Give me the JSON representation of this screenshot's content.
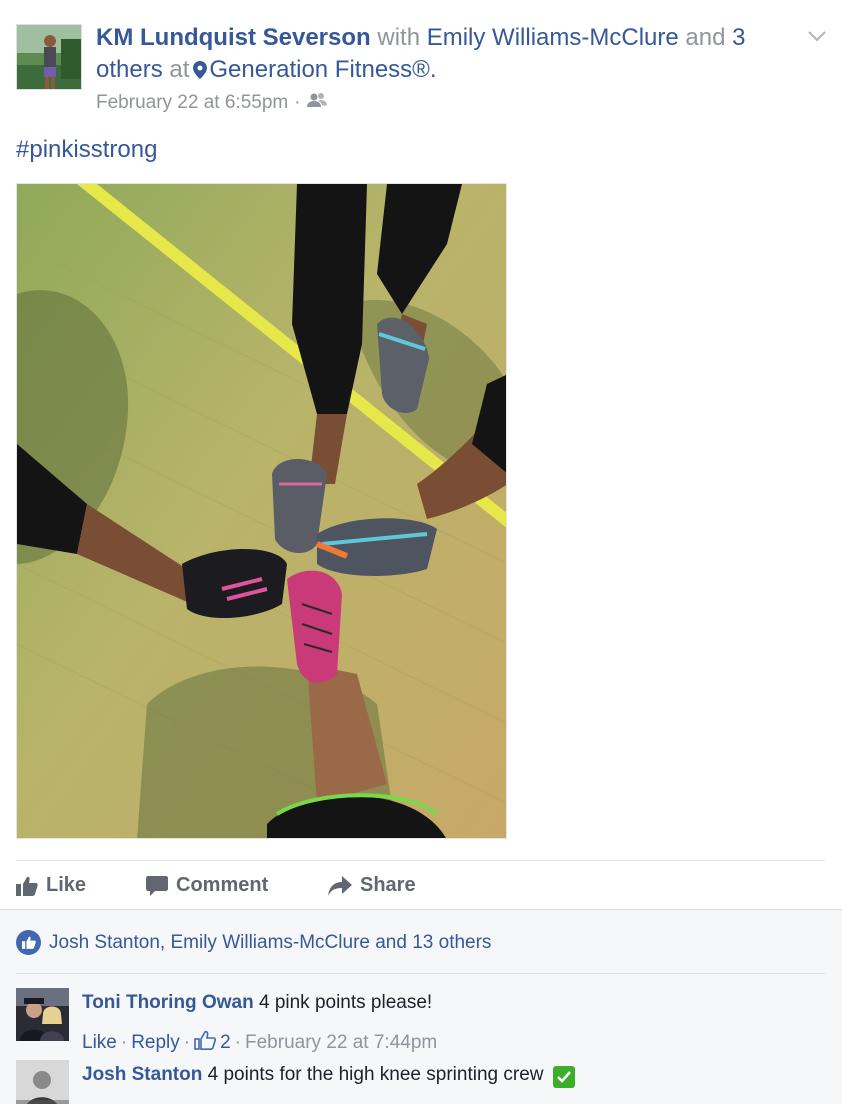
{
  "post": {
    "author": "KM Lundquist Severson",
    "with_word": "with",
    "tagged": "Emily Williams-McClure",
    "and_word": "and",
    "others": "3 others",
    "at_word": "at",
    "location": "Generation Fitness®",
    "period": ".",
    "timestamp": "February 22 at 6:55pm",
    "separator": "·",
    "audience_icon": "friends-icon",
    "message": "#pinkisstrong"
  },
  "actions": {
    "like": "Like",
    "comment": "Comment",
    "share": "Share"
  },
  "likes_summary": "Josh Stanton, Emily Williams-McClure and 13 others",
  "comments": [
    {
      "name": "Toni Thoring Owan",
      "text": "4 pink points please!",
      "like": "Like",
      "reply": "Reply",
      "sep": "·",
      "like_count": "2",
      "time": "February 22 at 7:44pm"
    },
    {
      "name": "Josh Stanton",
      "text": "4 points for the high knee sprinting crew",
      "emoji": "check-mark-icon"
    }
  ],
  "colors": {
    "link": "#365899",
    "meta": "#90949c",
    "like_blue": "#4267b2",
    "ufi_bg": "#f6f7f9"
  }
}
